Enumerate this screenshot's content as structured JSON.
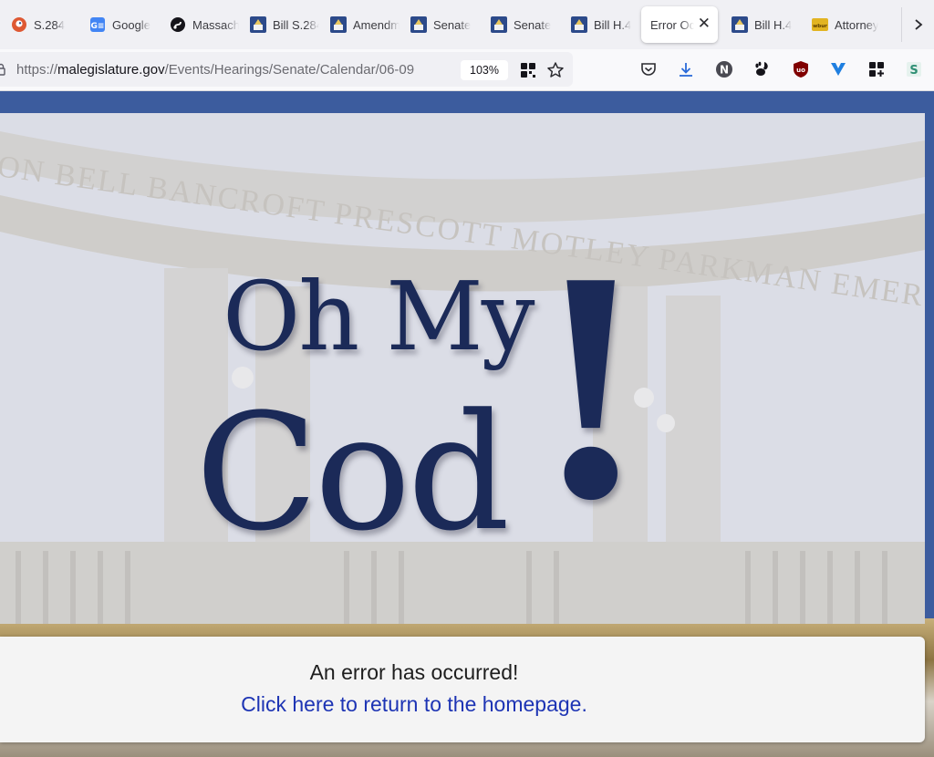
{
  "browser": {
    "tabs": [
      {
        "title": "S.284",
        "icon": "duckduckgo-icon",
        "color": "#de5833",
        "active": false
      },
      {
        "title": "Google",
        "icon": "google-docs-icon",
        "color": "#4285f4",
        "active": false
      },
      {
        "title": "Massachusetts",
        "icon": "audio-site-icon",
        "color": "#15141a",
        "active": false
      },
      {
        "title": "Bill S.284",
        "icon": "malegislature-icon",
        "color": "#2c4a8a",
        "active": false
      },
      {
        "title": "Amendment",
        "icon": "malegislature-icon",
        "color": "#2c4a8a",
        "active": false
      },
      {
        "title": "Senate",
        "icon": "malegislature-icon",
        "color": "#2c4a8a",
        "active": false
      },
      {
        "title": "Senate",
        "icon": "malegislature-icon",
        "color": "#2c4a8a",
        "active": false
      },
      {
        "title": "Bill H.4",
        "icon": "malegislature-icon",
        "color": "#2c4a8a",
        "active": false
      },
      {
        "title": "Error Occurred",
        "icon": "",
        "color": "",
        "active": true
      },
      {
        "title": "Bill H.4",
        "icon": "malegislature-icon",
        "color": "#2c4a8a",
        "active": false
      },
      {
        "title": "Attorney",
        "icon": "wbur-icon",
        "color": "#e2b422",
        "active": false
      }
    ],
    "url": {
      "scheme": "https://",
      "host": "malegislature.gov",
      "path": "/Events/Hearings/Senate/Calendar/06-09"
    },
    "zoom": "103%",
    "toolbar_icons": [
      "pocket-icon",
      "download-icon",
      "n-extension-icon",
      "gnome-extension-icon",
      "ublock-icon",
      "v-extension-icon",
      "extensions-grid-icon",
      "s-extension-icon"
    ]
  },
  "page": {
    "inscription": "ON BELL BANCROFT PRESCOTT MOTLEY PARKMAN EMERSON HAWTHORNE HOLMES",
    "logo": {
      "line1": "Oh My",
      "line2": "Cod",
      "bang": "!"
    },
    "error_message": "An error has occurred!",
    "home_link": "Click here to return to the homepage.",
    "colors": {
      "logo": "#1b2a58",
      "link": "#1d34b4",
      "frame": "#3c5c9e"
    }
  }
}
